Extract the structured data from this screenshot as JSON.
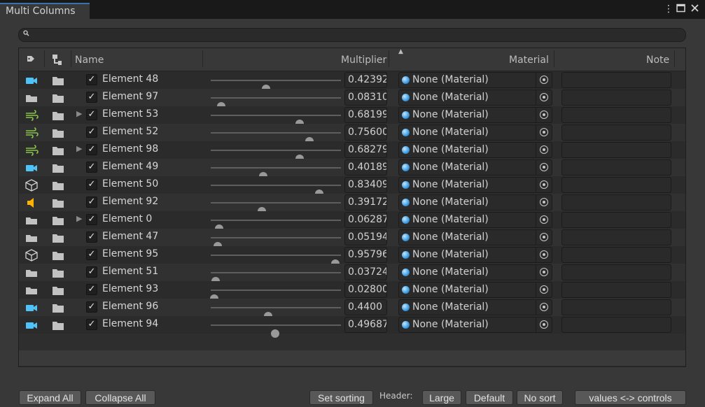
{
  "window": {
    "tab_title": "Multi Columns"
  },
  "search": {
    "placeholder": ""
  },
  "columns": {
    "name": "Name",
    "multiplier": "Multiplier",
    "material": "Material",
    "note": "Note"
  },
  "rows": [
    {
      "icon": "camera-icon",
      "expand": false,
      "name": "Element 48",
      "checked": true,
      "slider": 0.42392,
      "value": "0.42392",
      "material": "None (Material)"
    },
    {
      "icon": "folder-icon",
      "expand": false,
      "name": "Element 97",
      "checked": true,
      "slider": 0.0831,
      "value": "0.08310",
      "material": "None (Material)"
    },
    {
      "icon": "wind-icon",
      "expand": true,
      "name": "Element 53",
      "checked": true,
      "slider": 0.68199,
      "value": "0.68199",
      "material": "None (Material)"
    },
    {
      "icon": "wind-icon",
      "expand": false,
      "name": "Element 52",
      "checked": true,
      "slider": 0.756,
      "value": "0.75600",
      "material": "None (Material)"
    },
    {
      "icon": "wind-icon",
      "expand": true,
      "name": "Element 98",
      "checked": true,
      "slider": 0.68279,
      "value": "0.68279",
      "material": "None (Material)"
    },
    {
      "icon": "camera-icon",
      "expand": false,
      "name": "Element 49",
      "checked": true,
      "slider": 0.40189,
      "value": "0.40189",
      "material": "None (Material)"
    },
    {
      "icon": "cube-icon",
      "expand": false,
      "name": "Element 50",
      "checked": true,
      "slider": 0.83409,
      "value": "0.83409",
      "material": "None (Material)"
    },
    {
      "icon": "audio-icon",
      "expand": false,
      "name": "Element 92",
      "checked": true,
      "slider": 0.39172,
      "value": "0.39172",
      "material": "None (Material)"
    },
    {
      "icon": "folder-icon",
      "expand": true,
      "name": "Element 0",
      "checked": true,
      "slider": 0.06287,
      "value": "0.06287",
      "material": "None (Material)"
    },
    {
      "icon": "folder-icon",
      "expand": false,
      "name": "Element 47",
      "checked": true,
      "slider": 0.05194,
      "value": "0.05194",
      "material": "None (Material)"
    },
    {
      "icon": "cube-icon",
      "expand": false,
      "name": "Element 95",
      "checked": true,
      "slider": 0.95796,
      "value": "0.95796",
      "material": "None (Material)"
    },
    {
      "icon": "folder-icon",
      "expand": false,
      "name": "Element 51",
      "checked": true,
      "slider": 0.03724,
      "value": "0.03724",
      "material": "None (Material)"
    },
    {
      "icon": "folder-icon",
      "expand": false,
      "name": "Element 93",
      "checked": true,
      "slider": 0.028,
      "value": "0.02800",
      "material": "None (Material)"
    },
    {
      "icon": "camera-icon",
      "expand": false,
      "name": "Element 96",
      "checked": true,
      "slider": 0.44,
      "value": "0.4400",
      "material": "None (Material)"
    },
    {
      "icon": "camera-icon",
      "expand": false,
      "name": "Element 94",
      "checked": true,
      "slider": 0.49687,
      "value": "0.49687",
      "material": "None (Material)"
    }
  ],
  "footer": {
    "expand_all": "Expand All",
    "collapse_all": "Collapse All",
    "set_sorting": "Set sorting",
    "header_label": "Header:",
    "large": "Large",
    "default": "Default",
    "no_sort": "No sort",
    "toggle": "values <-> controls"
  },
  "colors": {
    "tab_accent": "#3a72b0",
    "icon_cyan": "#4fc3f7",
    "icon_green": "#8bc34a",
    "icon_orange": "#ffb300"
  }
}
